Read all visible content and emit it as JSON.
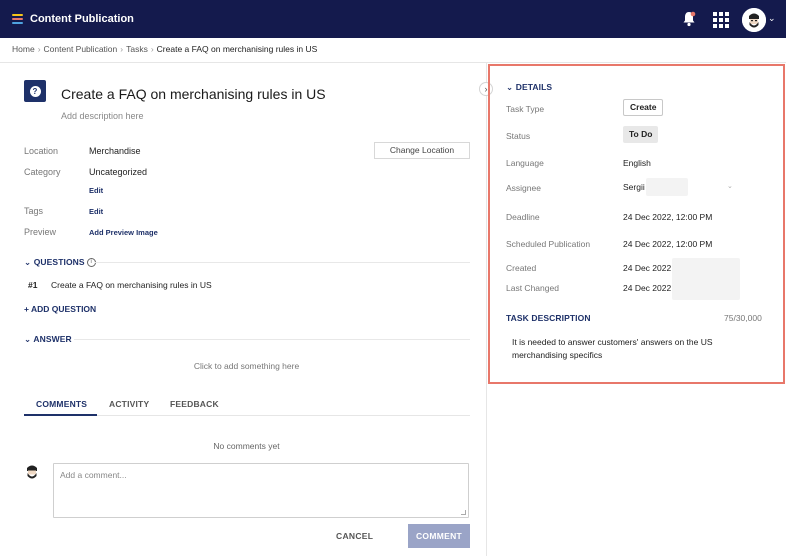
{
  "app": {
    "title": "Content Publication"
  },
  "colors": {
    "topbar": "#141a4d",
    "accent": "#1e3169",
    "highlight_frame": "#e8776a",
    "primary_disabled": "#9aa4c7"
  },
  "header": {
    "menu_icon": "hamburger-menu-icon",
    "bell_icon": "notification-bell-icon",
    "apps_icon": "apps-grid-icon",
    "avatar_icon": "user-avatar-icon"
  },
  "breadcrumb": {
    "items": [
      "Home",
      "Content Publication",
      "Tasks"
    ],
    "current": "Create a FAQ on merchanising rules in US",
    "separator": "›"
  },
  "task": {
    "icon": "question-bubble-icon",
    "title": "Create a FAQ on merchanising rules in US",
    "add_description": "Add description here"
  },
  "properties": {
    "location_label": "Location",
    "location_value": "Merchandise",
    "change_location": "Change Location",
    "category_label": "Category",
    "category_value": "Uncategorized",
    "category_edit": "Edit",
    "tags_label": "Tags",
    "tags_edit": "Edit",
    "preview_label": "Preview",
    "preview_action": "Add Preview Image"
  },
  "questions": {
    "heading": "QUESTIONS",
    "items": [
      {
        "num": "#1",
        "text": "Create a FAQ on merchanising rules in US"
      }
    ],
    "add": "+ ADD QUESTION"
  },
  "answer": {
    "heading": "ANSWER",
    "placeholder": "Click to add something here"
  },
  "tabs": [
    {
      "label": "COMMENTS",
      "active": true
    },
    {
      "label": "ACTIVITY",
      "active": false
    },
    {
      "label": "FEEDBACK",
      "active": false
    }
  ],
  "comments": {
    "empty": "No comments yet",
    "placeholder": "Add a comment...",
    "cancel": "CANCEL",
    "submit": "COMMENT"
  },
  "details": {
    "heading": "DETAILS",
    "rows": {
      "task_type": {
        "label": "Task Type",
        "value": "Create"
      },
      "status": {
        "label": "Status",
        "value": "To Do"
      },
      "language": {
        "label": "Language",
        "value": "English"
      },
      "assignee": {
        "label": "Assignee",
        "value": "Sergii"
      },
      "deadline": {
        "label": "Deadline",
        "value": "24 Dec 2022, 12:00 PM"
      },
      "scheduled": {
        "label": "Scheduled Publication",
        "value": "24 Dec 2022, 12:00 PM"
      },
      "created": {
        "label": "Created",
        "value": "24 Dec 2022"
      },
      "last_changed": {
        "label": "Last Changed",
        "value": "24 Dec 2022"
      }
    },
    "task_description": {
      "heading": "TASK DESCRIPTION",
      "count": "75/30,000",
      "text": "It is needed to answer customers' answers on the US merchandising specifics"
    }
  }
}
